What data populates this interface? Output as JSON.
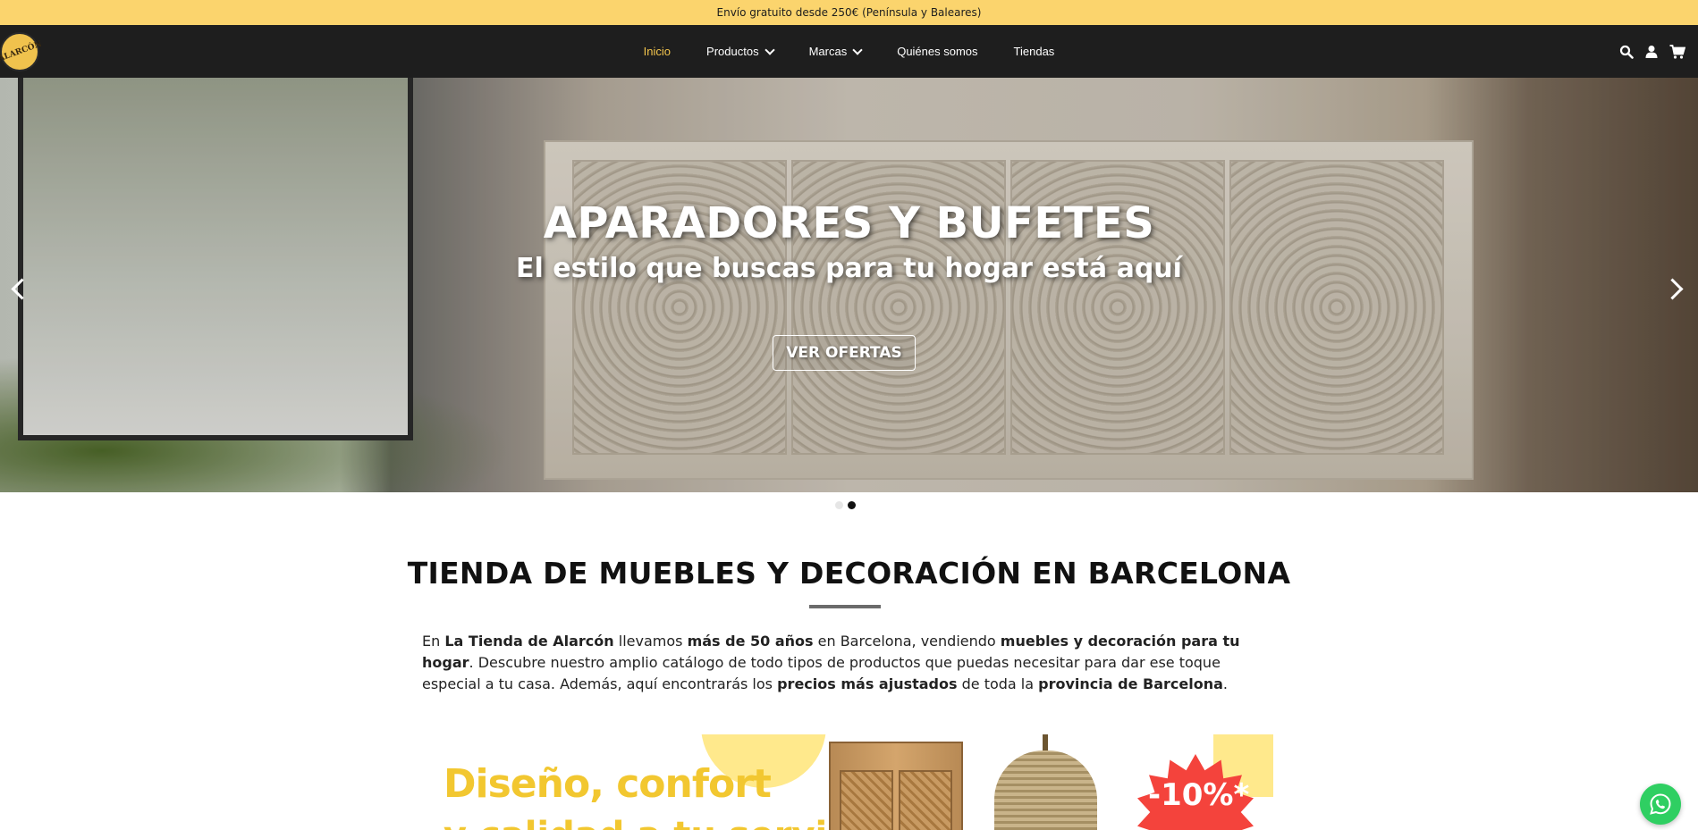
{
  "topbar": {
    "shipping_text": "Envío gratuito desde 250€ (Península y Baleares)"
  },
  "header": {
    "logo_text": "ALARCÓN",
    "menu": [
      {
        "label": "Inicio",
        "active": true
      },
      {
        "label": "Productos",
        "dropdown": true
      },
      {
        "label": "Marcas",
        "dropdown": true
      },
      {
        "label": "Quiénes somos"
      },
      {
        "label": "Tiendas"
      }
    ],
    "icons": [
      "search-icon",
      "user-icon",
      "cart-icon"
    ]
  },
  "hero": {
    "title": "APARADORES Y BUFETES",
    "subtitle": "El estilo que buscas para tu hogar está aquí",
    "button_label": "VER OFERTAS",
    "slide_count": 2,
    "active_slide": 2
  },
  "main": {
    "section_title": "TIENDA DE MUEBLES Y DECORACIÓN EN BARCELONA",
    "intro": {
      "p1": "En ",
      "b1": "La Tienda de Alarcón",
      "p2": " llevamos ",
      "b2": "más de 50 años",
      "p3": " en Barcelona, vendiendo ",
      "b3": "muebles y decoración para tu hogar",
      "p4": ". Descubre nuestro amplio catálogo de todo tipos de productos que puedas necesitar para dar ese toque especial a tu casa. Además, aquí encontrarás los ",
      "b4": "precios más ajustados",
      "p5": " de toda la ",
      "b5": "provincia de Barcelona",
      "p6": "."
    }
  },
  "promo_banner": {
    "headline": "Diseño, confort",
    "headline_line2": "y calidad a tu servicio",
    "discount": "-10%*"
  },
  "colors": {
    "topbar_bg": "#fbd46d",
    "nav_bg": "#1e1e1e",
    "accent": "#f3c54d",
    "whatsapp": "#2fcf62"
  }
}
